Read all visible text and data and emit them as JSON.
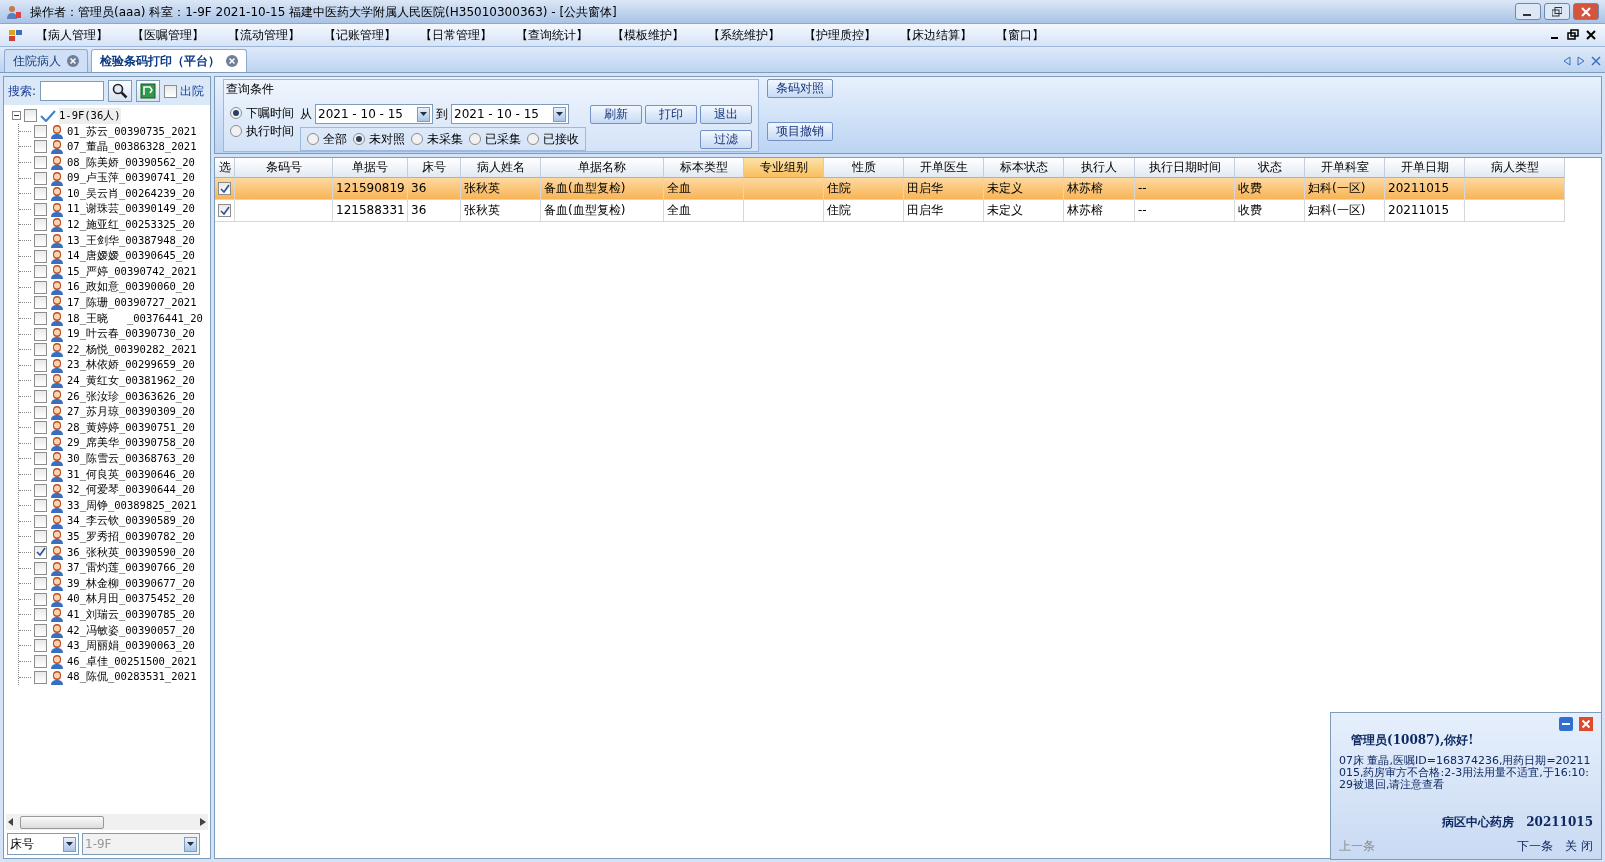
{
  "title_bar": {
    "text": "操作者：管理员(aaa)  科室：1-9F  2021-10-15  福建中医药大学附属人民医院(H35010300363) - [公共窗体]"
  },
  "menu": [
    "【病人管理】",
    "【医嘱管理】",
    "【流动管理】",
    "【记账管理】",
    "【日常管理】",
    "【查询统计】",
    "【模板维护】",
    "【系统维护】",
    "【护理质控】",
    "【床边结算】",
    "【窗口】"
  ],
  "tabs": [
    {
      "label": "住院病人",
      "selected": false
    },
    {
      "label": "检验条码打印（平台）",
      "selected": true
    }
  ],
  "search": {
    "label": "搜索:"
  },
  "discharged": {
    "label": "出院",
    "checked": false
  },
  "tree": {
    "label": "1-9F(36人)",
    "expanded": true,
    "checked": false,
    "children": [
      {
        "label": "01_苏云_00390735_2021",
        "checked": false
      },
      {
        "label": "07_董晶_00386328_2021",
        "checked": false
      },
      {
        "label": "08_陈美娇_00390562_20",
        "checked": false
      },
      {
        "label": "09_卢玉萍_00390741_20",
        "checked": false
      },
      {
        "label": "10_吴云肖_00264239_20",
        "checked": false
      },
      {
        "label": "11_谢珠芸_00390149_20",
        "checked": false
      },
      {
        "label": "12_施亚红_00253325_20",
        "checked": false
      },
      {
        "label": "13_王剑华_00387948_20",
        "checked": false
      },
      {
        "label": "14_唐嫒嫒_00390645_20",
        "checked": false
      },
      {
        "label": "15_严婷_00390742_2021",
        "checked": false
      },
      {
        "label": "16_政如意_00390060_20",
        "checked": false
      },
      {
        "label": "17_陈珊_00390727_2021",
        "checked": false
      },
      {
        "label": "18_王晓   _00376441_20",
        "checked": false
      },
      {
        "label": "19_叶云春_00390730_20",
        "checked": false
      },
      {
        "label": "22_杨悦_00390282_2021",
        "checked": false
      },
      {
        "label": "23_林依娇_00299659_20",
        "checked": false
      },
      {
        "label": "24_黄红女_00381962_20",
        "checked": false
      },
      {
        "label": "26_张汝珍_00363626_20",
        "checked": false
      },
      {
        "label": "27_苏月琼_00390309_20",
        "checked": false
      },
      {
        "label": "28_黄婷婷_00390751_20",
        "checked": false
      },
      {
        "label": "29_席美华_00390758_20",
        "checked": false
      },
      {
        "label": "30_陈雪云_00368763_20",
        "checked": false
      },
      {
        "label": "31_何良英_00390646_20",
        "checked": false
      },
      {
        "label": "32_何爱琴_00390644_20",
        "checked": false
      },
      {
        "label": "33_周铮_00389825_2021",
        "checked": false
      },
      {
        "label": "34_李云钦_00390589_20",
        "checked": false
      },
      {
        "label": "35_罗秀招_00390782_20",
        "checked": false
      },
      {
        "label": "36_张秋英_00390590_20",
        "checked": true
      },
      {
        "label": "37_雷灼莲_00390766_20",
        "checked": false
      },
      {
        "label": "39_林金柳_00390677_20",
        "checked": false
      },
      {
        "label": "40_林月田_00375452_20",
        "checked": false
      },
      {
        "label": "41_刘瑞云_00390785_20",
        "checked": false
      },
      {
        "label": "42_冯敏姿_00390057_20",
        "checked": false
      },
      {
        "label": "43_周丽娟_00390063_20",
        "checked": false
      },
      {
        "label": "46_卓佳_00251500_2021",
        "checked": false
      },
      {
        "label": "48_陈侃_00283531_2021",
        "checked": false
      }
    ]
  },
  "bottom": {
    "sort_field": "床号",
    "ward": "1-9F"
  },
  "query": {
    "title": "查询条件",
    "time_options": [
      {
        "label": "下嘱时间",
        "selected": true
      },
      {
        "label": "执行时间",
        "selected": false
      }
    ],
    "from_label": "从",
    "from_date": "2021 - 10 - 15",
    "to_label": "到",
    "to_date": "2021 - 10 - 15",
    "buttons": [
      "刷新",
      "打印",
      "退出",
      "过滤"
    ],
    "status_options": [
      {
        "label": "全部",
        "selected": false
      },
      {
        "label": "未对照",
        "selected": true
      },
      {
        "label": "未采集",
        "selected": false
      },
      {
        "label": "已采集",
        "selected": false
      },
      {
        "label": "已接收",
        "selected": false
      }
    ],
    "side_buttons": [
      "条码对照",
      "项目撤销"
    ]
  },
  "table": {
    "columns": [
      {
        "label": "选",
        "highlighted": false
      },
      {
        "label": "条码号",
        "highlighted": false
      },
      {
        "label": "单据号",
        "highlighted": false
      },
      {
        "label": "床号",
        "highlighted": false
      },
      {
        "label": "病人姓名",
        "highlighted": false
      },
      {
        "label": "单据名称",
        "highlighted": false
      },
      {
        "label": "标本类型",
        "highlighted": false
      },
      {
        "label": "专业组别",
        "highlighted": true
      },
      {
        "label": "性质",
        "highlighted": false
      },
      {
        "label": "开单医生",
        "highlighted": false
      },
      {
        "label": "标本状态",
        "highlighted": false
      },
      {
        "label": "执行人",
        "highlighted": false
      },
      {
        "label": "执行日期时间",
        "highlighted": false
      },
      {
        "label": "状态",
        "highlighted": false
      },
      {
        "label": "开单科室",
        "highlighted": false
      },
      {
        "label": "开单日期",
        "highlighted": false
      },
      {
        "label": "病人类型",
        "highlighted": false
      }
    ],
    "rows": [
      {
        "selected": true,
        "checked": true,
        "cells": [
          "",
          "",
          "121590819",
          "36",
          "张秋英",
          "备血(血型复检)",
          "全血",
          "",
          "住院",
          "田启华",
          "未定义",
          "林苏榕",
          "--",
          "收费",
          "妇科(一区)",
          "20211015",
          ""
        ]
      },
      {
        "selected": false,
        "checked": true,
        "cells": [
          "",
          "",
          "121588331",
          "36",
          "张秋英",
          "备血(血型复检)",
          "全血",
          "",
          "住院",
          "田启华",
          "未定义",
          "林苏榕",
          "--",
          "收费",
          "妇科(一区)",
          "20211015",
          ""
        ]
      }
    ]
  },
  "notification": {
    "greeting": "管理员(10087),你好!",
    "message": "07床  董晶,医嘱ID=168374236,用药日期=20211015,药房审方不合格:2-3用法用量不适宜,于16:10:29被退回,请注意查看",
    "sender": "病区中心药房",
    "date": "20211015",
    "prev": {
      "label": "上一条",
      "disabled": true
    },
    "next": {
      "label": "下一条",
      "disabled": false
    },
    "close": "关 闭"
  }
}
